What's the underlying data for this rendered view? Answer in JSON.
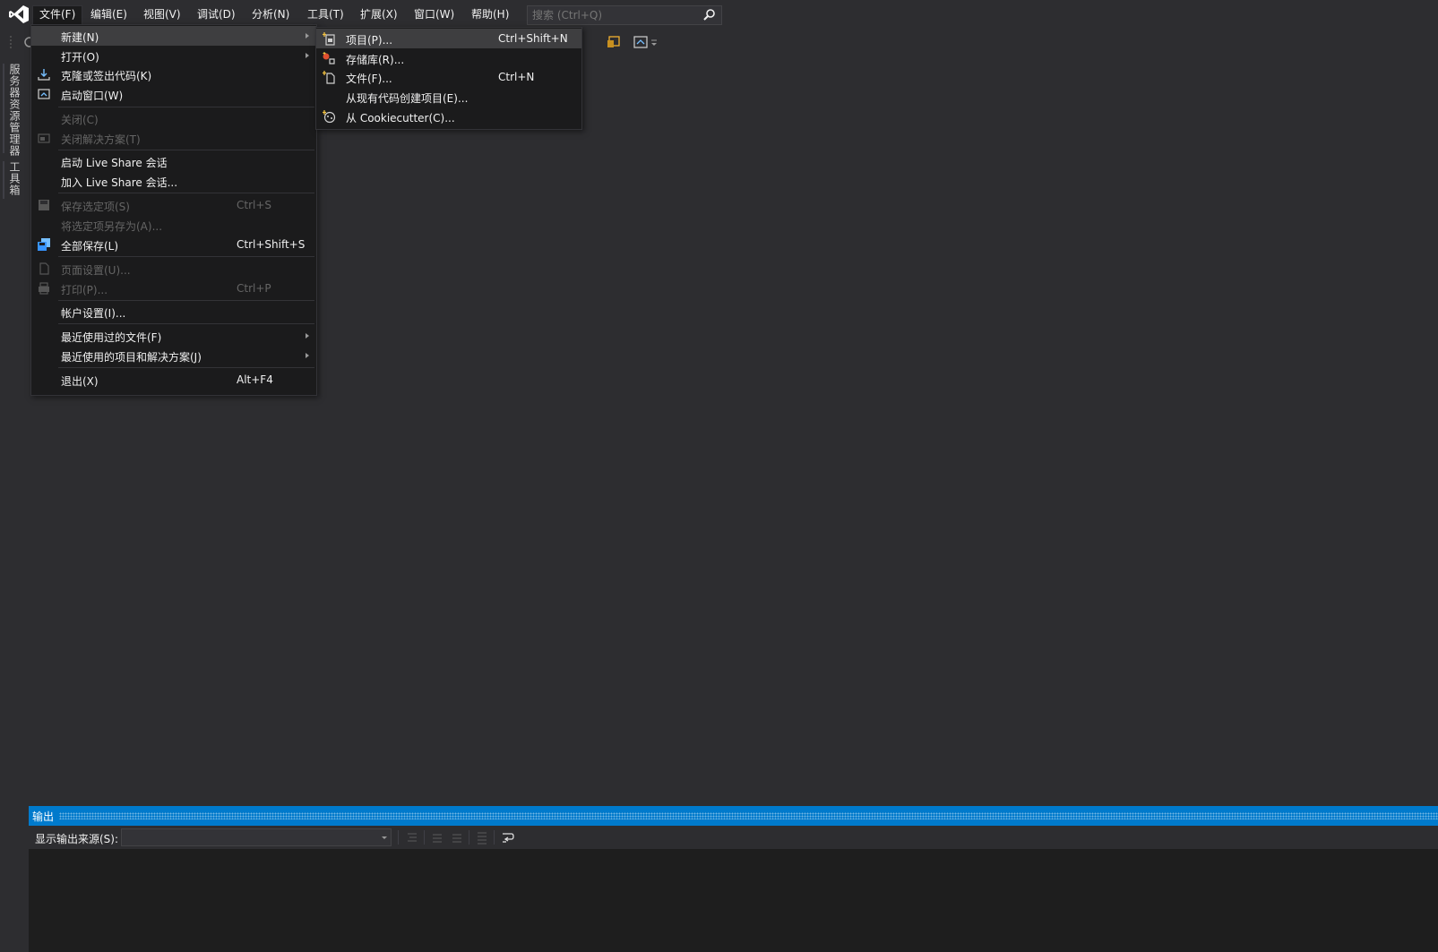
{
  "menubar": {
    "items": [
      {
        "label": "文件(F)"
      },
      {
        "label": "编辑(E)"
      },
      {
        "label": "视图(V)"
      },
      {
        "label": "调试(D)"
      },
      {
        "label": "分析(N)"
      },
      {
        "label": "工具(T)"
      },
      {
        "label": "扩展(X)"
      },
      {
        "label": "窗口(W)"
      },
      {
        "label": "帮助(H)"
      }
    ],
    "search_placeholder": "搜索 (Ctrl+Q)"
  },
  "side_tabs": {
    "server_explorer": "服务器资源管理器",
    "toolbox": "工具箱"
  },
  "file_menu": {
    "items": [
      {
        "label": "新建(N)",
        "shortcut": ""
      },
      {
        "label": "打开(O)",
        "shortcut": ""
      },
      {
        "label": "克隆或签出代码(K)",
        "shortcut": ""
      },
      {
        "label": "启动窗口(W)",
        "shortcut": ""
      },
      {
        "label": "关闭(C)",
        "shortcut": ""
      },
      {
        "label": "关闭解决方案(T)",
        "shortcut": ""
      },
      {
        "label": "启动 Live Share 会话",
        "shortcut": ""
      },
      {
        "label": "加入 Live Share 会话...",
        "shortcut": ""
      },
      {
        "label": "保存选定项(S)",
        "shortcut": "Ctrl+S"
      },
      {
        "label": "将选定项另存为(A)...",
        "shortcut": ""
      },
      {
        "label": "全部保存(L)",
        "shortcut": "Ctrl+Shift+S"
      },
      {
        "label": "页面设置(U)...",
        "shortcut": ""
      },
      {
        "label": "打印(P)...",
        "shortcut": "Ctrl+P"
      },
      {
        "label": "帐户设置(I)...",
        "shortcut": ""
      },
      {
        "label": "最近使用过的文件(F)",
        "shortcut": ""
      },
      {
        "label": "最近使用的项目和解决方案(J)",
        "shortcut": ""
      },
      {
        "label": "退出(X)",
        "shortcut": "Alt+F4"
      }
    ]
  },
  "new_menu": {
    "items": [
      {
        "label": "项目(P)...",
        "shortcut": "Ctrl+Shift+N"
      },
      {
        "label": "存储库(R)...",
        "shortcut": ""
      },
      {
        "label": "文件(F)...",
        "shortcut": "Ctrl+N"
      },
      {
        "label": "从现有代码创建项目(E)...",
        "shortcut": ""
      },
      {
        "label": "从 Cookiecutter(C)...",
        "shortcut": ""
      }
    ]
  },
  "output": {
    "title": "输出",
    "source_label": "显示输出来源(S):",
    "source_value": ""
  },
  "colors": {
    "accent": "#007acc",
    "background": "#2d2d30",
    "menu_background": "#1b1b1c",
    "disabled_text": "#656565"
  }
}
